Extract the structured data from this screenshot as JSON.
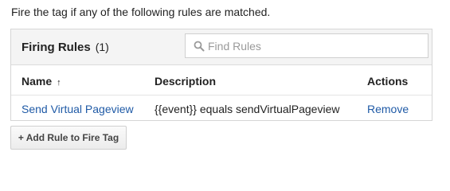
{
  "intro_text": "Fire the tag if any of the following rules are matched.",
  "panel": {
    "title": "Firing Rules",
    "count": "(1)",
    "search": {
      "placeholder": "Find Rules",
      "value": "",
      "icon": "search-icon"
    }
  },
  "table": {
    "headers": {
      "name": "Name",
      "sort_indicator": "↑",
      "description": "Description",
      "actions": "Actions"
    },
    "rows": [
      {
        "name": "Send Virtual Pageview",
        "description": "{{event}} equals sendVirtualPageview",
        "action": "Remove"
      }
    ]
  },
  "add_button": {
    "label": "+ Add Rule to Fire Tag"
  },
  "colors": {
    "link": "#1f5aa6",
    "header_bg": "#f4f4f4",
    "border": "#d6d6d6"
  }
}
